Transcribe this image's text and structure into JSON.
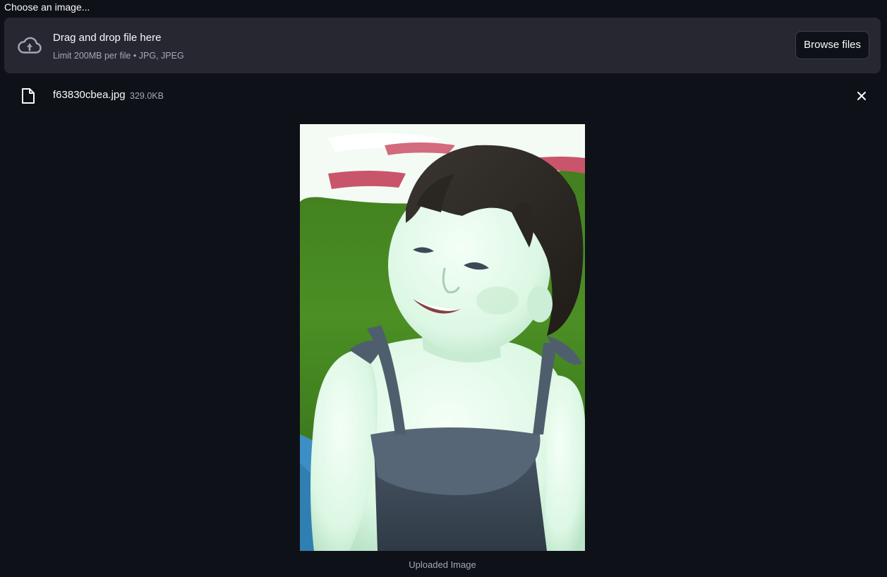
{
  "uploader": {
    "label": "Choose an image...",
    "dropzone": {
      "title": "Drag and drop file here",
      "subtitle": "Limit 200MB per file • JPG, JPEG",
      "icon": "cloud-upload-icon"
    },
    "browse_label": "Browse files"
  },
  "uploaded_file": {
    "name": "f63830cbea.jpg",
    "size": "329.0KB",
    "icon": "file-icon",
    "remove_icon": "close-icon"
  },
  "image": {
    "caption": "Uploaded Image"
  },
  "colors": {
    "background": "#0e1117",
    "dropzone": "#262730",
    "text": "#fafafa",
    "muted_text": "#a3a8b8"
  }
}
